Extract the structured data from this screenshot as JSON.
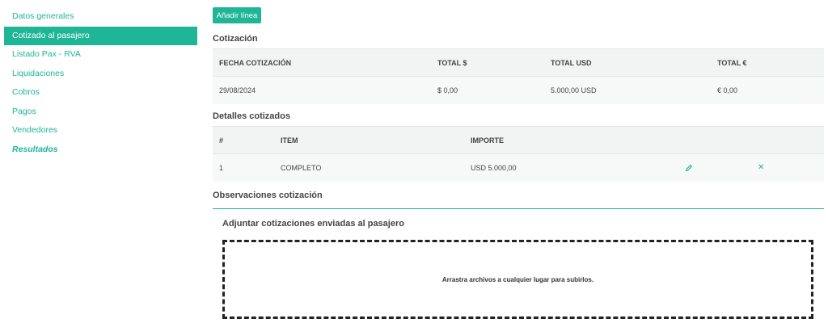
{
  "sidebar": {
    "items": [
      {
        "label": "Datos generales"
      },
      {
        "label": "Cotizado al pasajero"
      },
      {
        "label": "Listado Pax - RVA"
      },
      {
        "label": "Liquidaciones"
      },
      {
        "label": "Cobros"
      },
      {
        "label": "Pagos"
      },
      {
        "label": "Vendedores"
      },
      {
        "label": "Resultados"
      }
    ]
  },
  "toolbar": {
    "add_line_label": "Añadir línea"
  },
  "quote": {
    "title": "Cotización",
    "headers": [
      "FECHA COTIZACIÓN",
      "TOTAL $",
      "TOTAL USD",
      "TOTAL €"
    ],
    "row": [
      "29/08/2024",
      "$ 0,00",
      "5.000,00 USD",
      "€ 0,00"
    ]
  },
  "details": {
    "title": "Detalles cotizados",
    "headers": [
      "#",
      "ITEM",
      "IMPORTE"
    ],
    "rows": [
      {
        "num": "1",
        "item": "COMPLETO",
        "amount": "USD 5.000,00"
      }
    ],
    "edit_icon": "pencil-icon",
    "delete_icon": "close-icon"
  },
  "observations": {
    "title": "Observaciones cotización"
  },
  "attachments": {
    "title": "Adjuntar cotizaciones enviadas al pasajero",
    "dropzone_text": "Arrastra archivos a cualquier lugar para subirlos."
  },
  "colors": {
    "accent": "#1fb597",
    "header_bg": "#f2f3f3",
    "row_bg": "#f7f8f8"
  }
}
